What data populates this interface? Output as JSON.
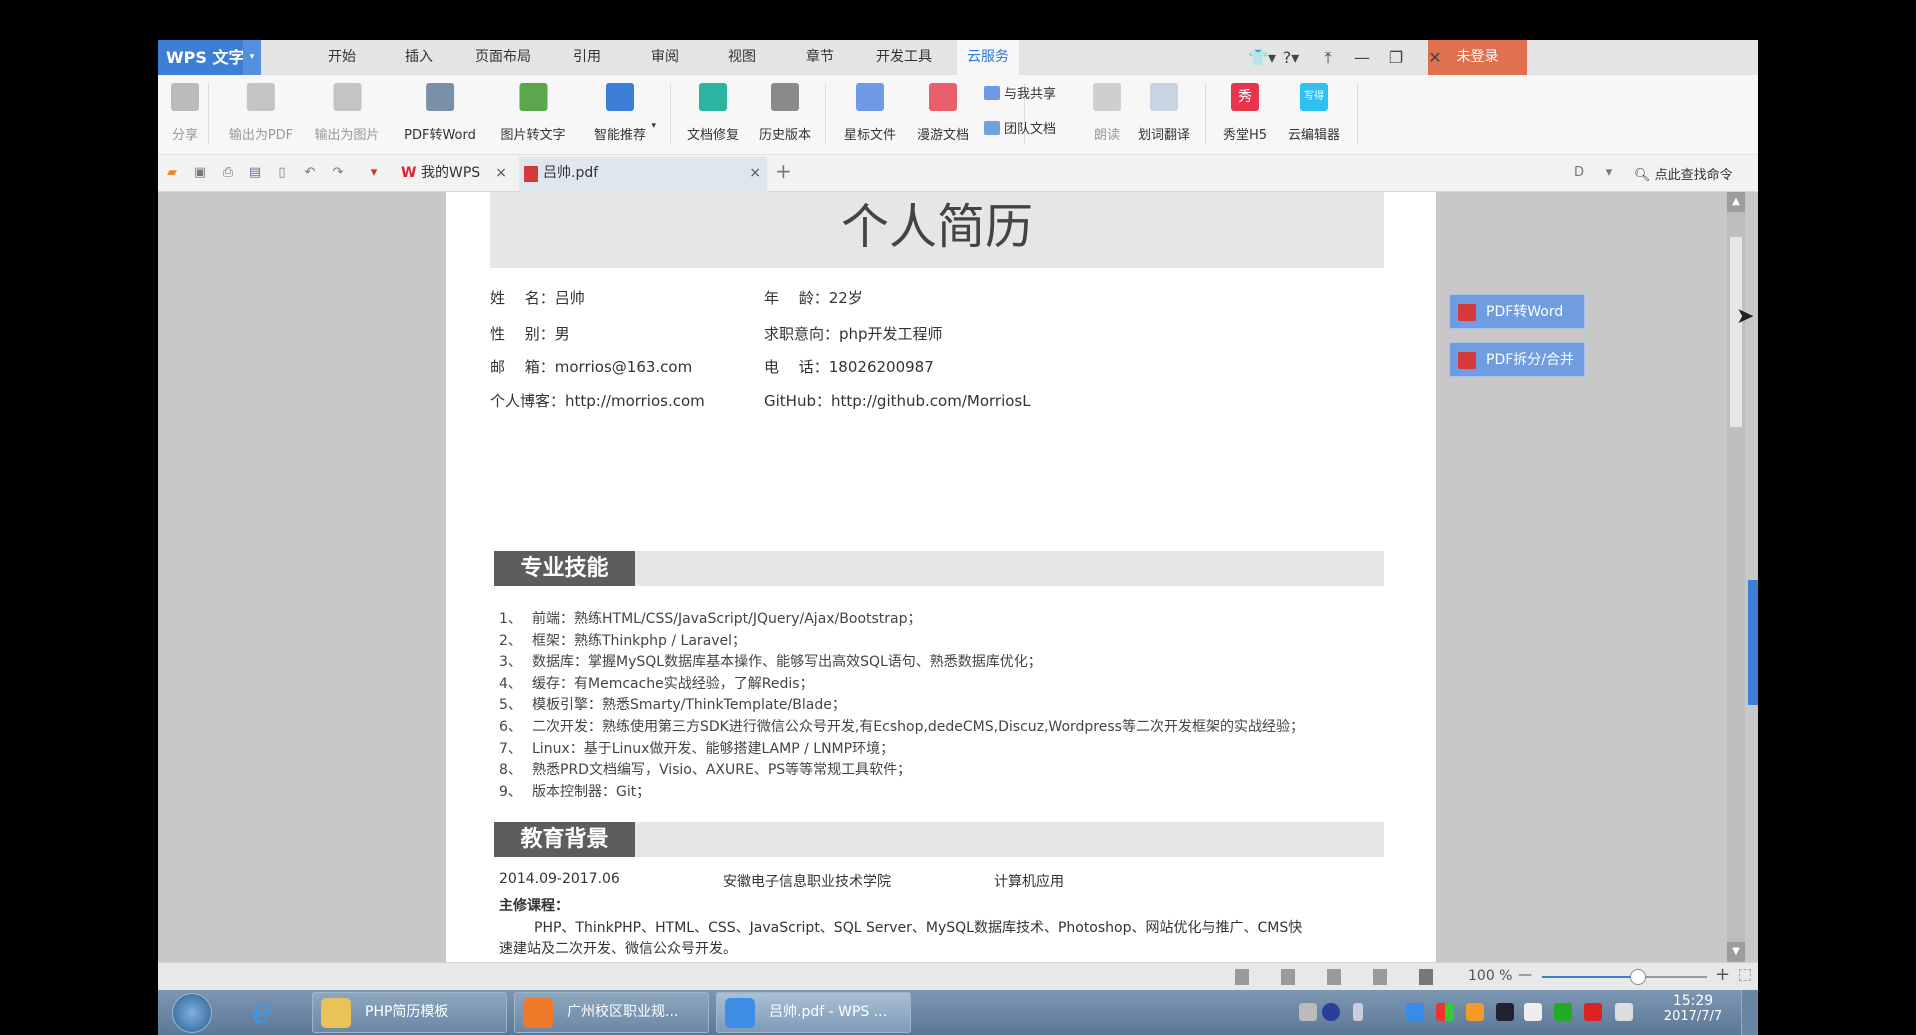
{
  "app": {
    "logo": "WPS 文字",
    "login": "未登录"
  },
  "menu_tabs": [
    "开始",
    "插入",
    "页面布局",
    "引用",
    "审阅",
    "视图",
    "章节",
    "开发工具",
    "云服务"
  ],
  "active_menu": "云服务",
  "window_controls": {
    "skin": "👕▾",
    "help": "?▾",
    "pin": "⤒",
    "minimize": "—",
    "restore": "❐",
    "close": "✕"
  },
  "ribbon": {
    "items": [
      {
        "label": "分享",
        "icon": "share-icon",
        "color": "#bbbbbb",
        "disabled": true
      },
      {
        "label": "输出为PDF",
        "icon": "export-pdf-icon",
        "color": "#c4c4c4",
        "disabled": true
      },
      {
        "label": "输出为图片",
        "icon": "export-image-icon",
        "color": "#c4c4c4",
        "disabled": true
      },
      {
        "label": "PDF转Word",
        "icon": "pdf-to-word-icon",
        "color": "#7a8fa8"
      },
      {
        "label": "图片转文字",
        "icon": "image-to-text-icon",
        "color": "#5aa84b"
      },
      {
        "label": "智能推荐",
        "icon": "recommend-icon",
        "color": "#3d7fd6",
        "dropdown": true
      },
      {
        "label": "文档修复",
        "icon": "doc-repair-icon",
        "color": "#2bb5a0"
      },
      {
        "label": "历史版本",
        "icon": "history-icon",
        "color": "#8a8a8a"
      },
      {
        "label": "星标文件",
        "icon": "star-folder-icon",
        "color": "#6f9be6"
      },
      {
        "label": "漫游文档",
        "icon": "roaming-folder-icon",
        "color": "#e95f6b"
      },
      {
        "label": "朗读",
        "icon": "microphone-icon",
        "color": "#cfcfcf",
        "disabled": true
      },
      {
        "label": "划词翻译",
        "icon": "translate-icon",
        "color": "#c9d4e2"
      },
      {
        "label": "秀堂H5",
        "icon": "xiutang-icon",
        "color": "#e8354e",
        "glyph": "秀"
      },
      {
        "label": "云编辑器",
        "icon": "cloud-editor-icon",
        "color": "#2ec1f0",
        "glyph": "写得"
      }
    ],
    "shared_with_me": "与我共享",
    "team_docs": "团队文档"
  },
  "doc_tabs": [
    {
      "label": "我的WPS"
    },
    {
      "label": "吕帅.pdf",
      "active": true
    }
  ],
  "search_command": "点此查找命令",
  "resume": {
    "title": "个人简历",
    "info": [
      [
        "姓　 名：吕帅",
        "年　 龄：22岁"
      ],
      [
        "性　 别：男",
        "求职意向：php开发工程师"
      ],
      [
        "邮　 箱：morrios@163.com",
        "电　 话：18026200987"
      ],
      [
        "个人博客：http://morrios.com",
        "GitHub：http://github.com/MorriosL"
      ]
    ],
    "skills_title": "专业技能",
    "skills": [
      "前端：熟练HTML/CSS/JavaScript/JQuery/Ajax/Bootstrap；",
      "框架：熟练Thinkphp / Laravel；",
      "数据库：掌握MySQL数据库基本操作、能够写出高效SQL语句、熟悉数据库优化；",
      "缓存：有Memcache实战经验，了解Redis；",
      "模板引擎：熟悉Smarty/ThinkTemplate/Blade；",
      "二次开发：熟练使用第三方SDK进行微信公众号开发,有Ecshop,dedeCMS,Discuz,Wordpress等二次开发框架的实战经验；",
      "Linux：基于Linux做开发、能够搭建LAMP / LNMP环境；",
      "熟悉PRD文档编写，Visio、AXURE、PS等等常规工具软件；",
      "版本控制器：Git；"
    ],
    "education_title": "教育背景",
    "education": {
      "period": "2014.09-2017.06",
      "school": "安徽电子信息职业技术学院",
      "major": "计算机应用",
      "courses_label": "主修课程：",
      "courses_line1": "PHP、ThinkPHP、HTML、CSS、JavaScript、SQL Server、MySQL数据库技术、Photoshop、网站优化与推广、CMS快",
      "courses_line2": "速建站及二次开发、微信公众号开发。"
    }
  },
  "side_panel": {
    "pdf_to_word": "PDF转Word",
    "pdf_split_merge": "PDF拆分/合并"
  },
  "status": {
    "zoom": "100 %",
    "zoom_percent": 100,
    "minus": "—",
    "plus": "+"
  },
  "taskbar": {
    "buttons": [
      {
        "label": "PHP简历模板",
        "color": "#e8c35a"
      },
      {
        "label": "广州校区职业规...",
        "color": "#f07a2a"
      },
      {
        "label": "吕帅.pdf - WPS ...",
        "color": "#3d8de6",
        "active": true
      }
    ],
    "time": "15:29",
    "date": "2017/7/7"
  }
}
